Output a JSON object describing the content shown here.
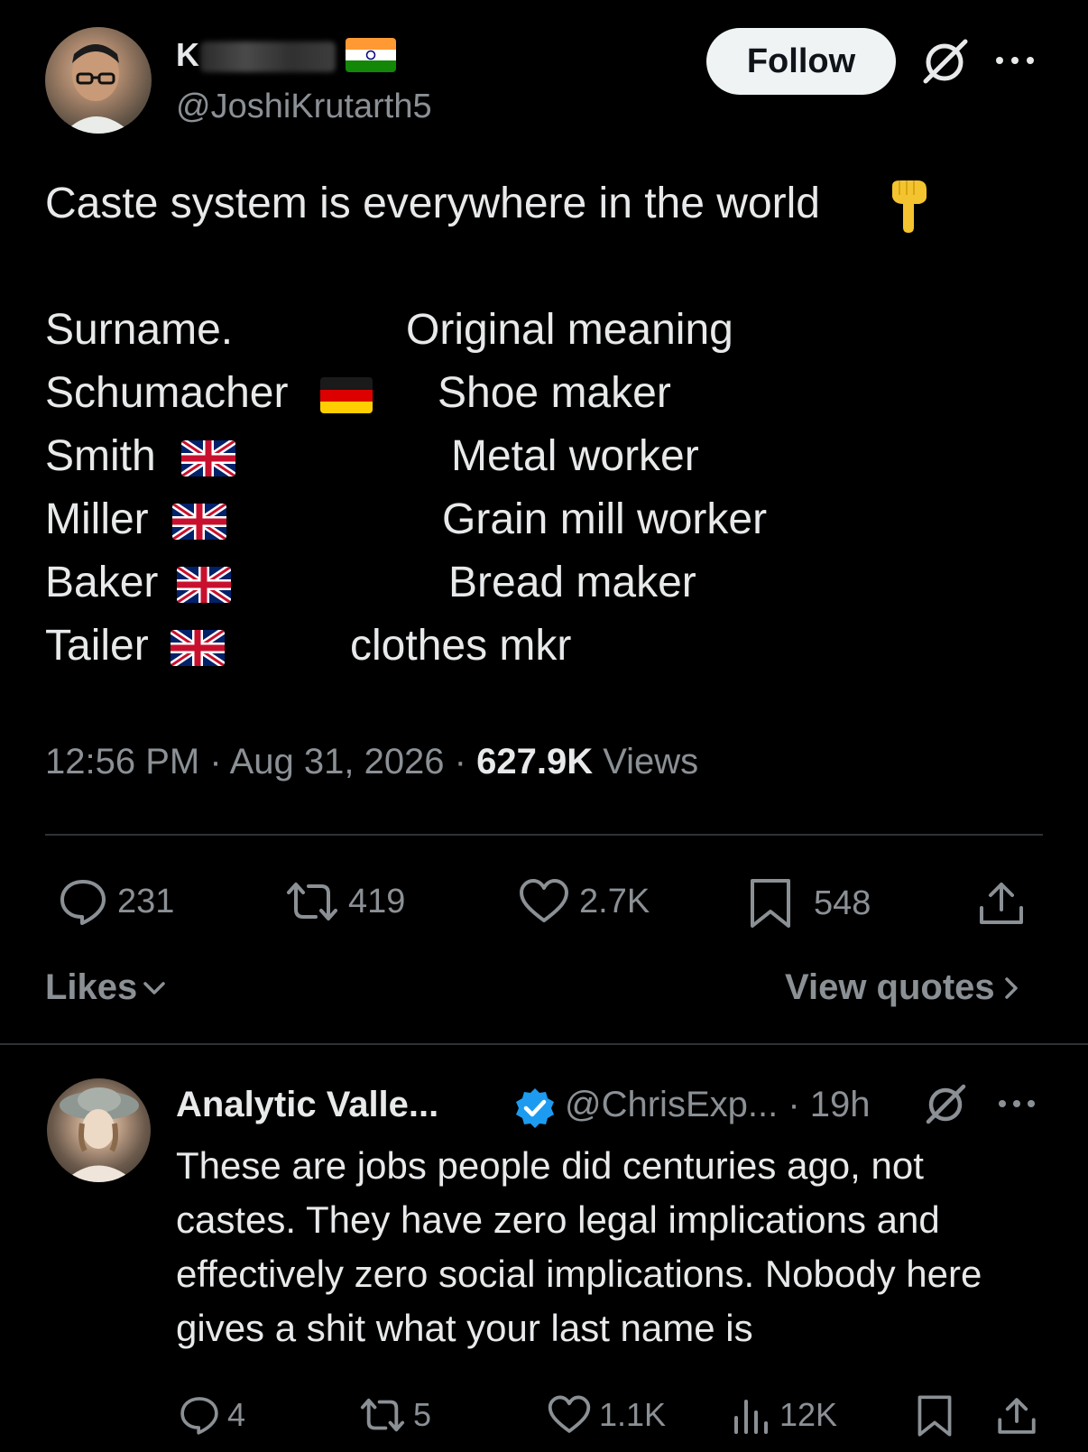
{
  "author": {
    "display_name": "K",
    "handle": "@JoshiKrutarth5",
    "flag": "india-flag"
  },
  "follow_label": "Follow",
  "tweet": {
    "intro": "Caste system is everywhere in the world",
    "intro_emoji": "👇",
    "table_header": {
      "surname": "Surname.",
      "meaning": "Original meaning"
    },
    "rows": [
      {
        "surname": "Schumacher",
        "flag": "germany-flag",
        "meaning": "Shoe maker"
      },
      {
        "surname": "Smith",
        "flag": "uk-flag",
        "meaning": "Metal worker"
      },
      {
        "surname": "Miller",
        "flag": "uk-flag",
        "meaning": "Grain mill worker"
      },
      {
        "surname": "Baker",
        "flag": "uk-flag",
        "meaning": "Bread maker"
      },
      {
        "surname": "Tailer",
        "flag": "uk-flag",
        "meaning": "clothes mkr"
      }
    ],
    "time": "12:56 PM",
    "sep1": " · ",
    "date": "Aug 31, 2026",
    "sep2": " · ",
    "views_count": "627.9K",
    "views_label": " Views"
  },
  "actions": {
    "replies": "231",
    "reposts": "419",
    "likes": "2.7K",
    "bookmarks": "548"
  },
  "links": {
    "likes": "Likes",
    "view_quotes": "View quotes"
  },
  "reply": {
    "display_name": "Analytic Valle...",
    "handle": "@ChrisExp...",
    "time": " · 19h",
    "text": "These are jobs people did centuries ago, not castes. They have zero legal implications and effectively zero social implications. Nobody here gives a shit what your last name is",
    "actions": {
      "replies": "4",
      "reposts": "5",
      "likes": "1.1K",
      "views": "12K"
    }
  },
  "colors": {
    "background": "#000000",
    "text": "#e7e9ea",
    "secondary": "#8b9095",
    "verified": "#1d9bf0",
    "divider": "#2f3336"
  }
}
